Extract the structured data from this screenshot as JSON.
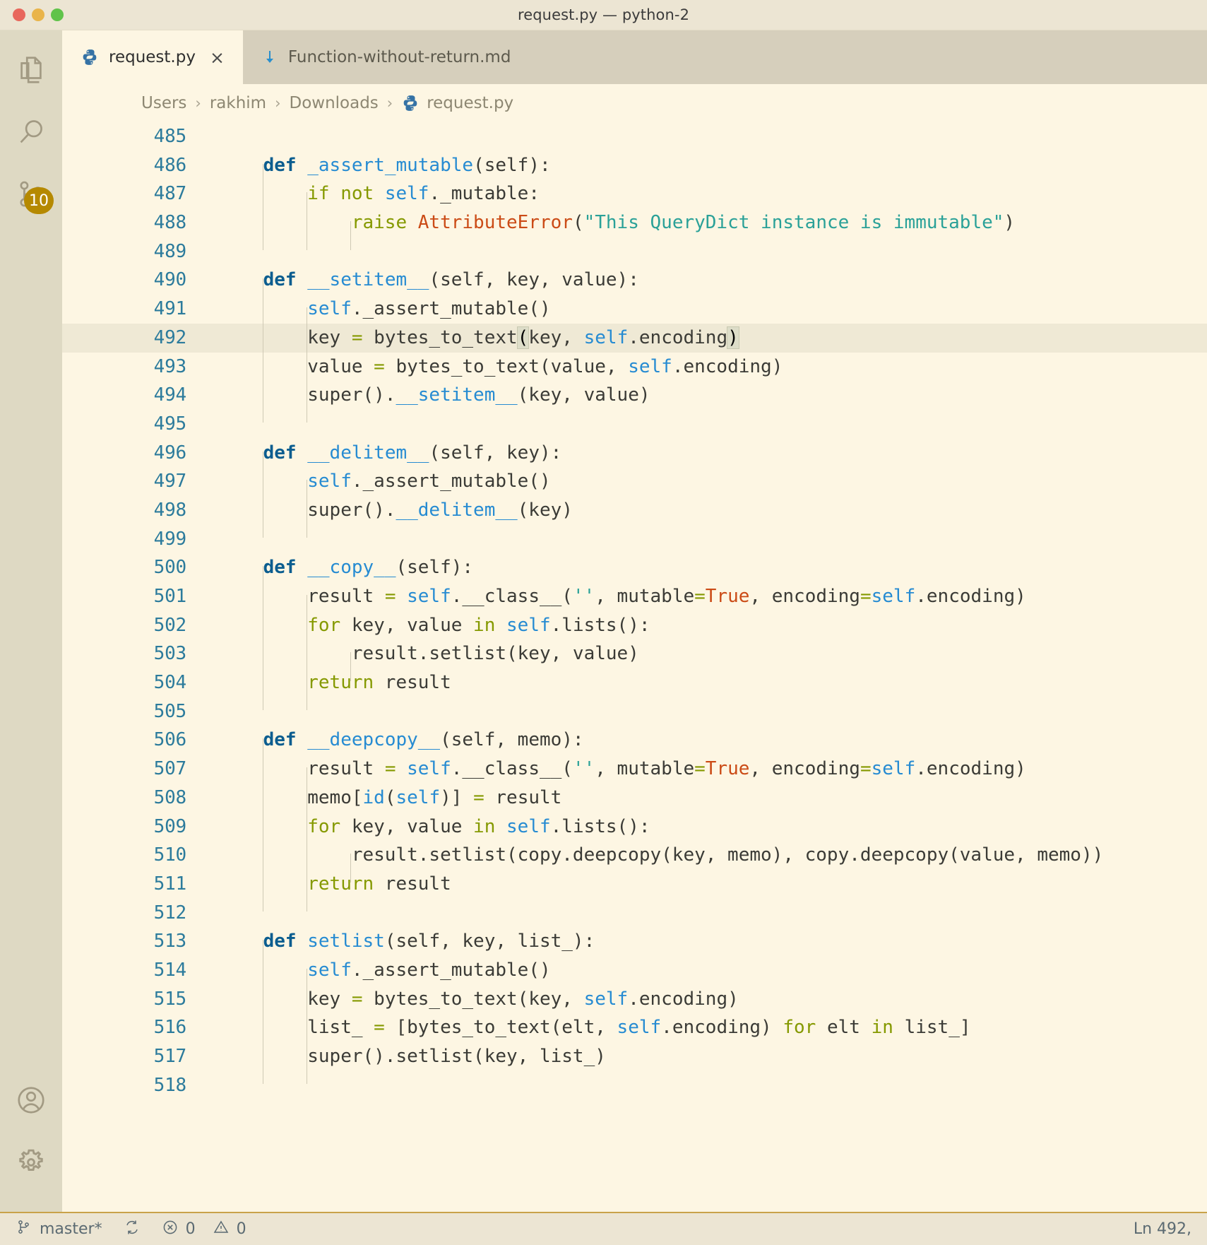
{
  "window": {
    "title": "request.py — python-2",
    "traffic_lights": [
      "close-button",
      "minimize-button",
      "maximize-button"
    ]
  },
  "activity_bar": {
    "items": [
      {
        "name": "explorer",
        "icon": "files-icon",
        "badge": null
      },
      {
        "name": "search",
        "icon": "search-icon",
        "badge": null
      },
      {
        "name": "source-control",
        "icon": "source-control-icon",
        "badge": "10"
      }
    ],
    "bottom_items": [
      {
        "name": "accounts",
        "icon": "account-icon"
      },
      {
        "name": "manage",
        "icon": "gear-icon"
      }
    ]
  },
  "tabs": [
    {
      "label": "request.py",
      "icon": "python-icon",
      "active": true,
      "close": "×"
    },
    {
      "label": "Function-without-return.md",
      "icon": "markdown-icon",
      "active": false,
      "close": ""
    }
  ],
  "breadcrumb": {
    "separator": "›",
    "items": [
      "Users",
      "rakhim",
      "Downloads"
    ],
    "file": "request.py",
    "file_icon": "python-icon"
  },
  "editor": {
    "first_line": 485,
    "current_line": 492,
    "lines": [
      {
        "n": 485,
        "indent": 0,
        "tokens": []
      },
      {
        "n": 486,
        "indent": 1,
        "tokens": [
          {
            "t": "    ",
            "c": "pl"
          },
          {
            "t": "def ",
            "c": "defk"
          },
          {
            "t": "_assert_mutable",
            "c": "fn"
          },
          {
            "t": "(self):",
            "c": "pl"
          }
        ]
      },
      {
        "n": 487,
        "indent": 2,
        "tokens": [
          {
            "t": "        ",
            "c": "pl"
          },
          {
            "t": "if",
            "c": "k"
          },
          {
            "t": " ",
            "c": "pl"
          },
          {
            "t": "not",
            "c": "k"
          },
          {
            "t": " ",
            "c": "pl"
          },
          {
            "t": "self",
            "c": "sf"
          },
          {
            "t": "._mutable:",
            "c": "pl"
          }
        ]
      },
      {
        "n": 488,
        "indent": 3,
        "tokens": [
          {
            "t": "            ",
            "c": "pl"
          },
          {
            "t": "raise",
            "c": "k"
          },
          {
            "t": " ",
            "c": "pl"
          },
          {
            "t": "AttributeError",
            "c": "cls"
          },
          {
            "t": "(",
            "c": "pl"
          },
          {
            "t": "\"This QueryDict instance is immutable\"",
            "c": "str"
          },
          {
            "t": ")",
            "c": "pl"
          }
        ]
      },
      {
        "n": 489,
        "indent": 0,
        "tokens": []
      },
      {
        "n": 490,
        "indent": 1,
        "tokens": [
          {
            "t": "    ",
            "c": "pl"
          },
          {
            "t": "def ",
            "c": "defk"
          },
          {
            "t": "__setitem__",
            "c": "fn"
          },
          {
            "t": "(self, key, value):",
            "c": "pl"
          }
        ]
      },
      {
        "n": 491,
        "indent": 2,
        "tokens": [
          {
            "t": "        ",
            "c": "pl"
          },
          {
            "t": "self",
            "c": "sf"
          },
          {
            "t": "._assert_mutable()",
            "c": "pl"
          }
        ]
      },
      {
        "n": 492,
        "indent": 2,
        "tokens": [
          {
            "t": "        ",
            "c": "pl"
          },
          {
            "t": "key ",
            "c": "pl"
          },
          {
            "t": "=",
            "c": "op"
          },
          {
            "t": " bytes_to_text",
            "c": "pl"
          },
          {
            "t": "(",
            "c": "bm"
          },
          {
            "t": "key, ",
            "c": "pl"
          },
          {
            "t": "self",
            "c": "sf"
          },
          {
            "t": ".encoding",
            "c": "pl"
          },
          {
            "t": ")",
            "c": "bm"
          }
        ]
      },
      {
        "n": 493,
        "indent": 2,
        "tokens": [
          {
            "t": "        ",
            "c": "pl"
          },
          {
            "t": "value ",
            "c": "pl"
          },
          {
            "t": "=",
            "c": "op"
          },
          {
            "t": " bytes_to_text(value, ",
            "c": "pl"
          },
          {
            "t": "self",
            "c": "sf"
          },
          {
            "t": ".encoding)",
            "c": "pl"
          }
        ]
      },
      {
        "n": 494,
        "indent": 2,
        "tokens": [
          {
            "t": "        ",
            "c": "pl"
          },
          {
            "t": "super().",
            "c": "pl"
          },
          {
            "t": "__setitem__",
            "c": "fn"
          },
          {
            "t": "(key, value)",
            "c": "pl"
          }
        ]
      },
      {
        "n": 495,
        "indent": 0,
        "tokens": []
      },
      {
        "n": 496,
        "indent": 1,
        "tokens": [
          {
            "t": "    ",
            "c": "pl"
          },
          {
            "t": "def ",
            "c": "defk"
          },
          {
            "t": "__delitem__",
            "c": "fn"
          },
          {
            "t": "(self, key):",
            "c": "pl"
          }
        ]
      },
      {
        "n": 497,
        "indent": 2,
        "tokens": [
          {
            "t": "        ",
            "c": "pl"
          },
          {
            "t": "self",
            "c": "sf"
          },
          {
            "t": "._assert_mutable()",
            "c": "pl"
          }
        ]
      },
      {
        "n": 498,
        "indent": 2,
        "tokens": [
          {
            "t": "        ",
            "c": "pl"
          },
          {
            "t": "super().",
            "c": "pl"
          },
          {
            "t": "__delitem__",
            "c": "fn"
          },
          {
            "t": "(key)",
            "c": "pl"
          }
        ]
      },
      {
        "n": 499,
        "indent": 0,
        "tokens": []
      },
      {
        "n": 500,
        "indent": 1,
        "tokens": [
          {
            "t": "    ",
            "c": "pl"
          },
          {
            "t": "def ",
            "c": "defk"
          },
          {
            "t": "__copy__",
            "c": "fn"
          },
          {
            "t": "(self):",
            "c": "pl"
          }
        ]
      },
      {
        "n": 501,
        "indent": 2,
        "tokens": [
          {
            "t": "        ",
            "c": "pl"
          },
          {
            "t": "result ",
            "c": "pl"
          },
          {
            "t": "=",
            "c": "op"
          },
          {
            "t": " ",
            "c": "pl"
          },
          {
            "t": "self",
            "c": "sf"
          },
          {
            "t": ".__class__(",
            "c": "pl"
          },
          {
            "t": "''",
            "c": "str"
          },
          {
            "t": ", mutable",
            "c": "pl"
          },
          {
            "t": "=",
            "c": "op"
          },
          {
            "t": "True",
            "c": "cls"
          },
          {
            "t": ", encoding",
            "c": "pl"
          },
          {
            "t": "=",
            "c": "op"
          },
          {
            "t": "self",
            "c": "sf"
          },
          {
            "t": ".encoding)",
            "c": "pl"
          }
        ]
      },
      {
        "n": 502,
        "indent": 2,
        "tokens": [
          {
            "t": "        ",
            "c": "pl"
          },
          {
            "t": "for",
            "c": "k"
          },
          {
            "t": " key, value ",
            "c": "pl"
          },
          {
            "t": "in",
            "c": "k"
          },
          {
            "t": " ",
            "c": "pl"
          },
          {
            "t": "self",
            "c": "sf"
          },
          {
            "t": ".lists():",
            "c": "pl"
          }
        ]
      },
      {
        "n": 503,
        "indent": 3,
        "tokens": [
          {
            "t": "            ",
            "c": "pl"
          },
          {
            "t": "result.setlist(key, value)",
            "c": "pl"
          }
        ]
      },
      {
        "n": 504,
        "indent": 2,
        "tokens": [
          {
            "t": "        ",
            "c": "pl"
          },
          {
            "t": "return",
            "c": "k"
          },
          {
            "t": " result",
            "c": "pl"
          }
        ]
      },
      {
        "n": 505,
        "indent": 0,
        "tokens": []
      },
      {
        "n": 506,
        "indent": 1,
        "tokens": [
          {
            "t": "    ",
            "c": "pl"
          },
          {
            "t": "def ",
            "c": "defk"
          },
          {
            "t": "__deepcopy__",
            "c": "fn"
          },
          {
            "t": "(self, memo):",
            "c": "pl"
          }
        ]
      },
      {
        "n": 507,
        "indent": 2,
        "tokens": [
          {
            "t": "        ",
            "c": "pl"
          },
          {
            "t": "result ",
            "c": "pl"
          },
          {
            "t": "=",
            "c": "op"
          },
          {
            "t": " ",
            "c": "pl"
          },
          {
            "t": "self",
            "c": "sf"
          },
          {
            "t": ".__class__(",
            "c": "pl"
          },
          {
            "t": "''",
            "c": "str"
          },
          {
            "t": ", mutable",
            "c": "pl"
          },
          {
            "t": "=",
            "c": "op"
          },
          {
            "t": "True",
            "c": "cls"
          },
          {
            "t": ", encoding",
            "c": "pl"
          },
          {
            "t": "=",
            "c": "op"
          },
          {
            "t": "self",
            "c": "sf"
          },
          {
            "t": ".encoding)",
            "c": "pl"
          }
        ]
      },
      {
        "n": 508,
        "indent": 2,
        "tokens": [
          {
            "t": "        ",
            "c": "pl"
          },
          {
            "t": "memo[",
            "c": "pl"
          },
          {
            "t": "id",
            "c": "fn"
          },
          {
            "t": "(",
            "c": "pl"
          },
          {
            "t": "self",
            "c": "sf"
          },
          {
            "t": ")] ",
            "c": "pl"
          },
          {
            "t": "=",
            "c": "op"
          },
          {
            "t": " result",
            "c": "pl"
          }
        ]
      },
      {
        "n": 509,
        "indent": 2,
        "tokens": [
          {
            "t": "        ",
            "c": "pl"
          },
          {
            "t": "for",
            "c": "k"
          },
          {
            "t": " key, value ",
            "c": "pl"
          },
          {
            "t": "in",
            "c": "k"
          },
          {
            "t": " ",
            "c": "pl"
          },
          {
            "t": "self",
            "c": "sf"
          },
          {
            "t": ".lists():",
            "c": "pl"
          }
        ]
      },
      {
        "n": 510,
        "indent": 3,
        "tokens": [
          {
            "t": "            ",
            "c": "pl"
          },
          {
            "t": "result.setlist(copy.deepcopy(key, memo), copy.deepcopy(value, memo))",
            "c": "pl"
          }
        ]
      },
      {
        "n": 511,
        "indent": 2,
        "tokens": [
          {
            "t": "        ",
            "c": "pl"
          },
          {
            "t": "return",
            "c": "k"
          },
          {
            "t": " result",
            "c": "pl"
          }
        ]
      },
      {
        "n": 512,
        "indent": 0,
        "tokens": []
      },
      {
        "n": 513,
        "indent": 1,
        "tokens": [
          {
            "t": "    ",
            "c": "pl"
          },
          {
            "t": "def ",
            "c": "defk"
          },
          {
            "t": "setlist",
            "c": "fn"
          },
          {
            "t": "(self, key, list_):",
            "c": "pl"
          }
        ]
      },
      {
        "n": 514,
        "indent": 2,
        "tokens": [
          {
            "t": "        ",
            "c": "pl"
          },
          {
            "t": "self",
            "c": "sf"
          },
          {
            "t": "._assert_mutable()",
            "c": "pl"
          }
        ]
      },
      {
        "n": 515,
        "indent": 2,
        "tokens": [
          {
            "t": "        ",
            "c": "pl"
          },
          {
            "t": "key ",
            "c": "pl"
          },
          {
            "t": "=",
            "c": "op"
          },
          {
            "t": " bytes_to_text(key, ",
            "c": "pl"
          },
          {
            "t": "self",
            "c": "sf"
          },
          {
            "t": ".encoding)",
            "c": "pl"
          }
        ]
      },
      {
        "n": 516,
        "indent": 2,
        "tokens": [
          {
            "t": "        ",
            "c": "pl"
          },
          {
            "t": "list_ ",
            "c": "pl"
          },
          {
            "t": "=",
            "c": "op"
          },
          {
            "t": " [bytes_to_text(elt, ",
            "c": "pl"
          },
          {
            "t": "self",
            "c": "sf"
          },
          {
            "t": ".encoding) ",
            "c": "pl"
          },
          {
            "t": "for",
            "c": "k"
          },
          {
            "t": " elt ",
            "c": "pl"
          },
          {
            "t": "in",
            "c": "k"
          },
          {
            "t": " list_]",
            "c": "pl"
          }
        ]
      },
      {
        "n": 517,
        "indent": 2,
        "tokens": [
          {
            "t": "        ",
            "c": "pl"
          },
          {
            "t": "super().setlist(key, list_)",
            "c": "pl"
          }
        ]
      },
      {
        "n": 518,
        "indent": 0,
        "tokens": []
      }
    ]
  },
  "status_bar": {
    "branch": "master*",
    "branch_icon": "source-control-icon",
    "sync_icon": "sync-icon",
    "errors_icon": "error-icon",
    "errors": "0",
    "warnings_icon": "warning-icon",
    "warnings": "0",
    "cursor_position": "Ln 492,"
  },
  "colors": {
    "editor_background": "#fdf6e3",
    "activity_bar_background": "#ded9c3",
    "titlebar_background": "#ece5d3",
    "tabs_background": "#d6cfbc",
    "keyword": "#859900",
    "function": "#268bd2",
    "string": "#2aa198",
    "class": "#cb4b16",
    "line_number": "#2c7b9c",
    "badge": "#b58900",
    "status_border": "#c9a24a"
  }
}
